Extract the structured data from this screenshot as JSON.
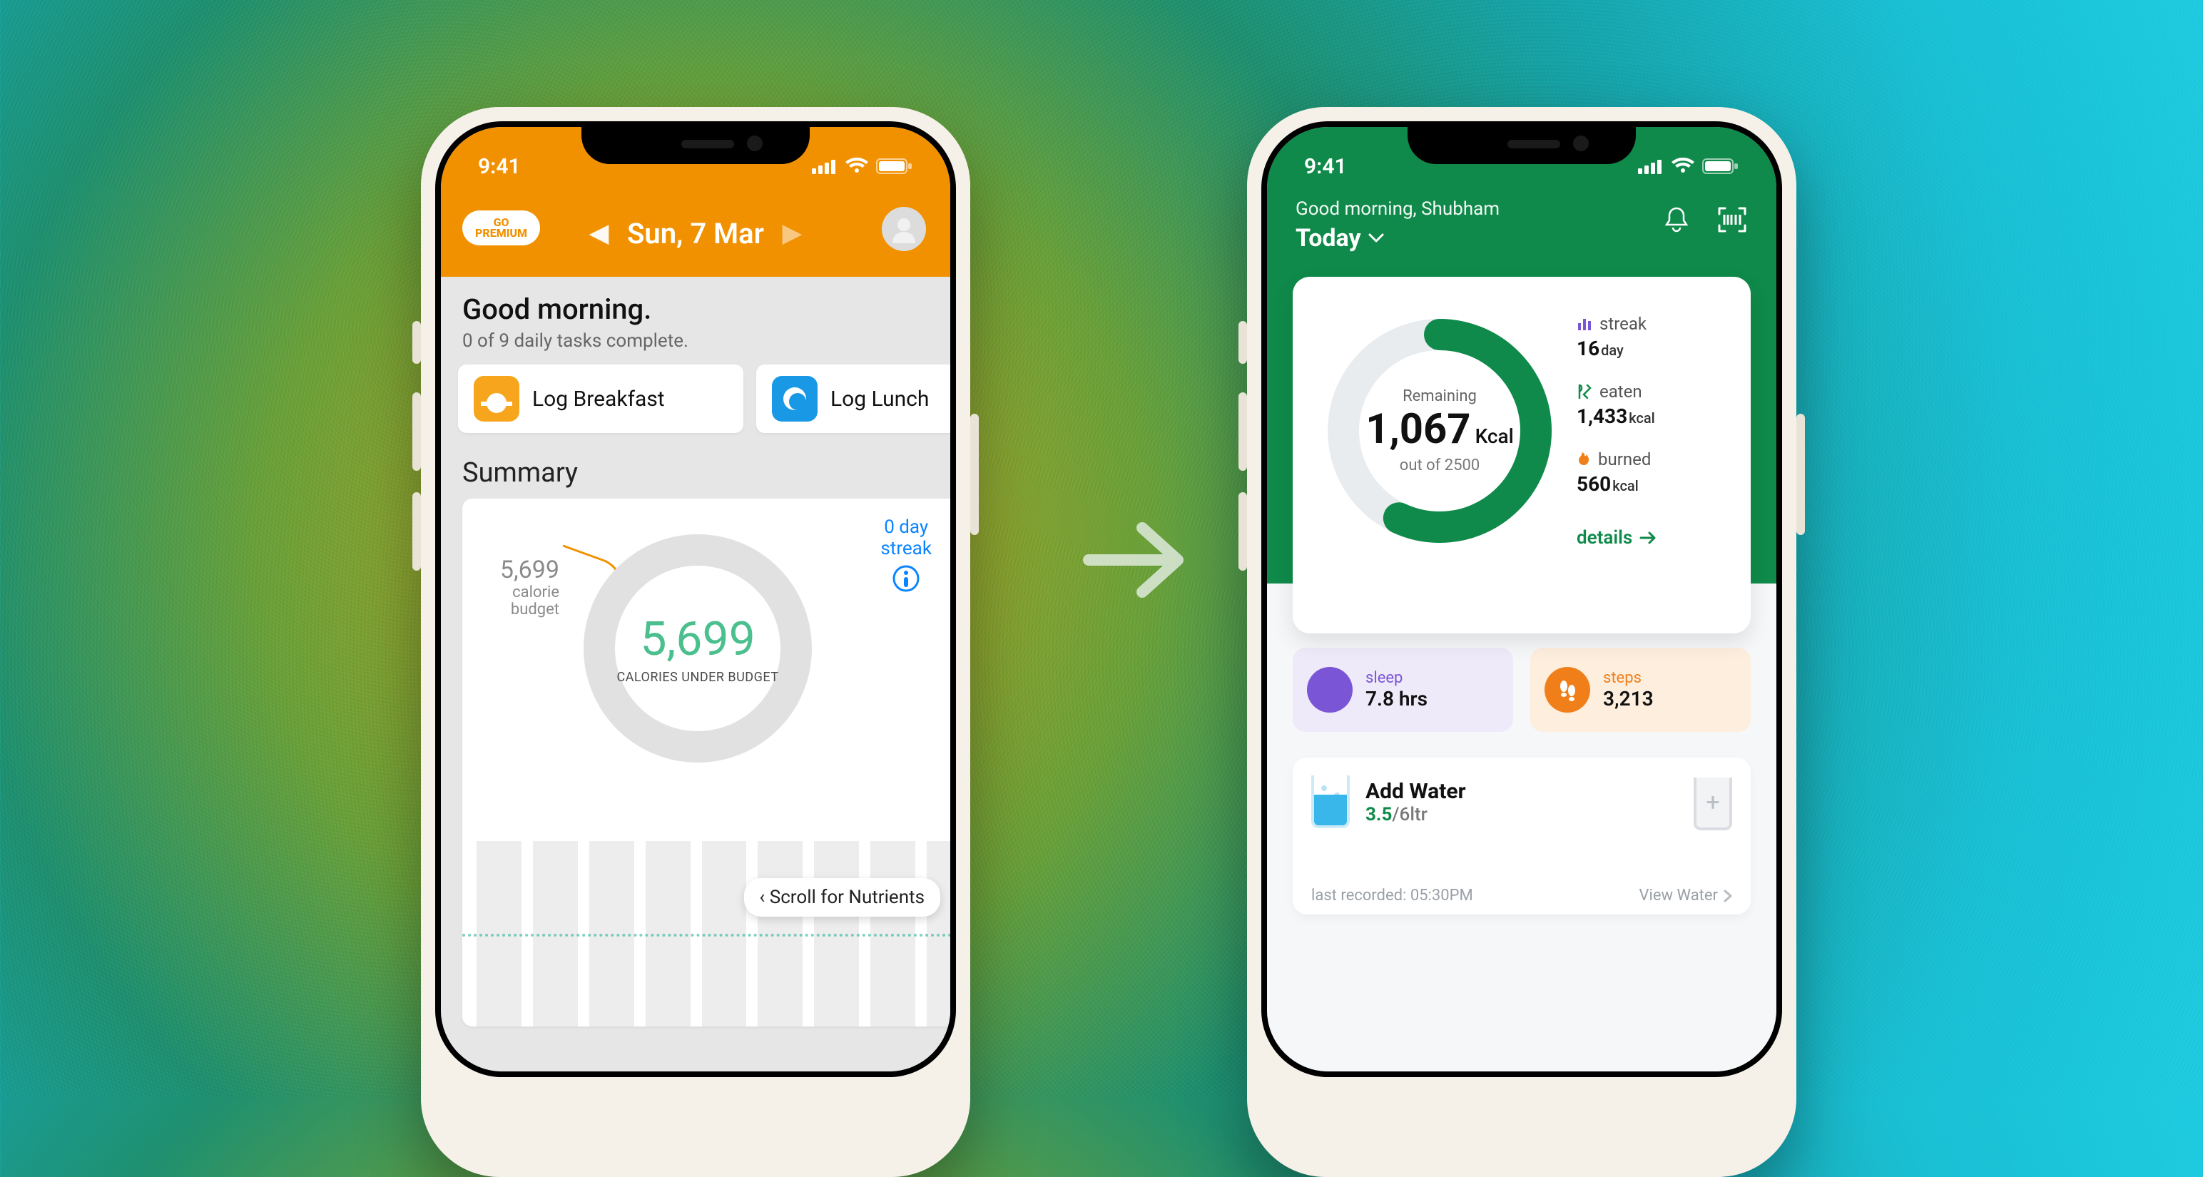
{
  "status": {
    "time": "9:41"
  },
  "appA": {
    "premium_chip_line1": "GO",
    "premium_chip_line2": "PREMIUM",
    "date": "Sun, 7 Mar",
    "greeting": "Good morning.",
    "tasks_line": "0 of 9 daily tasks complete.",
    "tasks": [
      {
        "label": "Log Breakfast"
      },
      {
        "label": "Log Lunch"
      }
    ],
    "section_title": "Summary",
    "budget_value": "5,699",
    "budget_caption": "calorie budget",
    "ring_value": "5,699",
    "ring_caption": "CALORIES UNDER BUDGET",
    "streak_value": "0 day",
    "streak_word": "streak",
    "scroll_tip": "‹ Scroll for Nutrients"
  },
  "appB": {
    "greeting": "Good morning, Shubham",
    "today": "Today",
    "kcal": {
      "remaining_label": "Remaining",
      "remaining": "1,067",
      "unit": "Kcal",
      "outof": "out of 2500",
      "progress": 0.57
    },
    "metrics": {
      "streak": {
        "label": "streak",
        "value": "16",
        "unit": "day"
      },
      "eaten": {
        "label": "eaten",
        "value": "1,433",
        "unit": "kcal"
      },
      "burned": {
        "label": "burned",
        "value": "560",
        "unit": "kcal"
      }
    },
    "details": "details",
    "stat": {
      "sleep": {
        "label": "sleep",
        "value": "7.8 hrs"
      },
      "steps": {
        "label": "steps",
        "value": "3,213"
      }
    },
    "water": {
      "title": "Add Water",
      "current": "3.5",
      "sep": "/",
      "total": "6",
      "unit": "ltr",
      "last": "last recorded: 05:30PM",
      "view": "View Water"
    }
  }
}
